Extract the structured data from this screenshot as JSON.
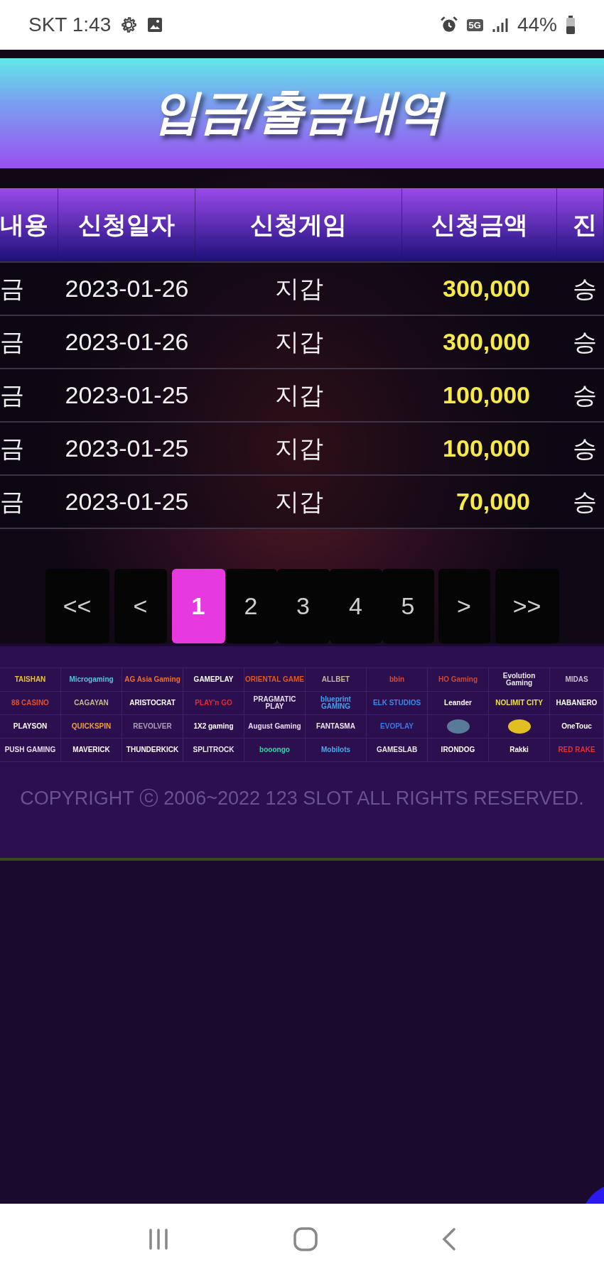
{
  "status_bar": {
    "carrier_time": "SKT 1:43",
    "network": "5G",
    "battery": "44%"
  },
  "title": "입금/출금내역",
  "table": {
    "columns": [
      "내용",
      "신청일자",
      "신청게임",
      "신청금액",
      "진"
    ],
    "rows": [
      {
        "cells": [
          "금",
          "2023-01-26",
          "지갑",
          "300,000",
          "승"
        ]
      },
      {
        "cells": [
          "금",
          "2023-01-26",
          "지갑",
          "300,000",
          "승"
        ]
      },
      {
        "cells": [
          "금",
          "2023-01-25",
          "지갑",
          "100,000",
          "승"
        ]
      },
      {
        "cells": [
          "금",
          "2023-01-25",
          "지갑",
          "100,000",
          "승"
        ]
      },
      {
        "cells": [
          "금",
          "2023-01-25",
          "지갑",
          "70,000",
          "승"
        ]
      }
    ]
  },
  "pagination": [
    {
      "label": "<<",
      "selected": false
    },
    {
      "label": "<",
      "selected": false
    },
    {
      "label": "1",
      "selected": true
    },
    {
      "label": "2",
      "selected": false
    },
    {
      "label": "3",
      "selected": false
    },
    {
      "label": "4",
      "selected": false
    },
    {
      "label": "5",
      "selected": false
    },
    {
      "label": ">",
      "selected": false
    },
    {
      "label": ">>",
      "selected": false
    }
  ],
  "providers": [
    [
      {
        "kind": "wordmark",
        "text": "TAISHAN",
        "color": "#e8c23a"
      },
      {
        "kind": "wordmark",
        "text": "Microgaming",
        "color": "#5cc0e0"
      },
      {
        "kind": "wordmark",
        "text": "AG Asia Gaming",
        "color": "#f07030"
      },
      {
        "kind": "wordmark",
        "text": "GAMEPLAY",
        "color": "#ffffff"
      },
      {
        "kind": "wordmark",
        "text": "ORIENTAL GAME",
        "color": "#e05a20"
      },
      {
        "kind": "wordmark",
        "text": "ALLBET",
        "color": "#c8b89a"
      },
      {
        "kind": "wordmark",
        "text": "bbin",
        "color": "#e04a2a"
      },
      {
        "kind": "wordmark",
        "text": "HO Gaming",
        "color": "#c84a3a"
      },
      {
        "kind": "wordmark",
        "text": "Evolution Gaming",
        "color": "#e8e8e8"
      },
      {
        "kind": "wordmark",
        "text": "MIDAS",
        "color": "#c8c0d0"
      }
    ],
    [
      {
        "kind": "wordmark",
        "text": "88 CASINO",
        "color": "#e8502a"
      },
      {
        "kind": "wordmark",
        "text": "CAGAYAN",
        "color": "#c8b890"
      },
      {
        "kind": "wordmark",
        "text": "ARISTOCRAT",
        "color": "#ffffff"
      },
      {
        "kind": "wordmark",
        "text": "PLAY'n GO",
        "color": "#e82a2a"
      },
      {
        "kind": "wordmark",
        "text": "PRAGMATIC PLAY",
        "color": "#e8e0f0"
      },
      {
        "kind": "wordmark",
        "text": "blueprint GAMING",
        "color": "#4aa0f0"
      },
      {
        "kind": "wordmark",
        "text": "ELK STUDIOS",
        "color": "#3a8ae8"
      },
      {
        "kind": "wordmark",
        "text": "Leander",
        "color": "#ffffff"
      },
      {
        "kind": "wordmark",
        "text": "NOLIMIT CITY",
        "color": "#f0e040"
      },
      {
        "kind": "wordmark",
        "text": "HABANERO",
        "color": "#ffffff"
      }
    ],
    [
      {
        "kind": "wordmark",
        "text": "PLAYSON",
        "color": "#ffffff"
      },
      {
        "kind": "wordmark",
        "text": "QUICKSPIN",
        "color": "#f0a040"
      },
      {
        "kind": "wordmark",
        "text": "REVOLVER",
        "color": "#a8a0b8"
      },
      {
        "kind": "wordmark",
        "text": "1X2 gaming",
        "color": "#ffffff"
      },
      {
        "kind": "wordmark",
        "text": "August Gaming",
        "color": "#e8e0f0"
      },
      {
        "kind": "wordmark",
        "text": "FANTASMA",
        "color": "#e8e8e8"
      },
      {
        "kind": "wordmark",
        "text": "EVOPLAY",
        "color": "#3a7ae8"
      },
      {
        "kind": "emblem",
        "color": "#5a7a9a"
      },
      {
        "kind": "emblem",
        "color": "#e0c020"
      },
      {
        "kind": "wordmark",
        "text": "OneTouc",
        "color": "#ffffff"
      }
    ],
    [
      {
        "kind": "wordmark",
        "text": "PUSH GAMING",
        "color": "#e8e0f0"
      },
      {
        "kind": "wordmark",
        "text": "MAVERICK",
        "color": "#ffffff"
      },
      {
        "kind": "wordmark",
        "text": "THUNDERKICK",
        "color": "#ffffff"
      },
      {
        "kind": "wordmark",
        "text": "SPLITROCK",
        "color": "#e8e8f0"
      },
      {
        "kind": "wordmark",
        "text": "booongo",
        "color": "#40d0b0"
      },
      {
        "kind": "wordmark",
        "text": "Mobilots",
        "color": "#40b0f0"
      },
      {
        "kind": "wordmark",
        "text": "GAMESLAB",
        "color": "#e8e8e8"
      },
      {
        "kind": "wordmark",
        "text": "IRONDOG",
        "color": "#ffffff"
      },
      {
        "kind": "wordmark",
        "text": "Rakki",
        "color": "#ffffff"
      },
      {
        "kind": "wordmark",
        "text": "RED RAKE",
        "color": "#e83030"
      }
    ]
  ],
  "copyright": "COPYRIGHT ⓒ 2006~2022 123 SLOT ALL RIGHTS RESERVED."
}
